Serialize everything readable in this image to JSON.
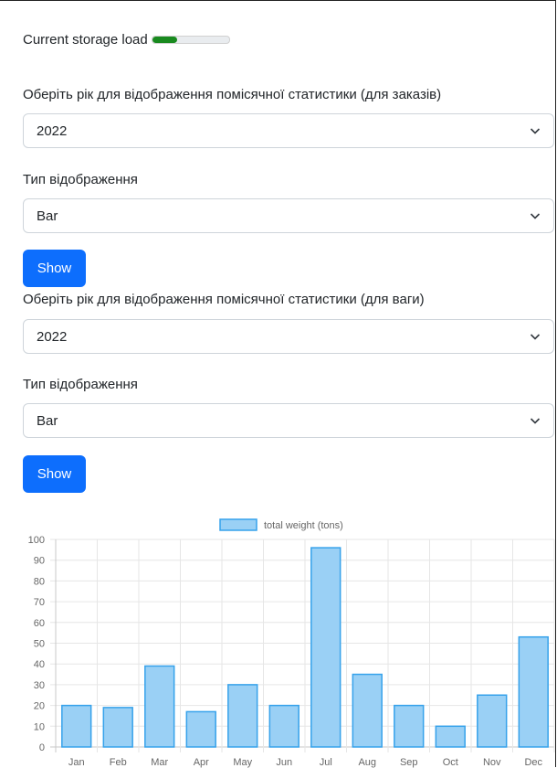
{
  "storage": {
    "label": "Current storage load",
    "fill_fraction": 0.32,
    "fill_color": "#198a1f"
  },
  "orders": {
    "year_label": "Оберіть рік для відображення помісячної статистики (для заказів)",
    "year_value": "2022",
    "type_label": "Тип відображення",
    "type_value": "Bar",
    "show_label": "Show"
  },
  "weight": {
    "year_label": "Оберіть рік для відображення помісячної статистики (для ваги)",
    "year_value": "2022",
    "type_label": "Тип відображення",
    "type_value": "Bar",
    "show_label": "Show"
  },
  "colors": {
    "primary": "#0d6efd",
    "bar_fill": "#9ad0f5",
    "bar_border": "#36a2eb"
  },
  "chart_data": {
    "type": "bar",
    "categories": [
      "Jan",
      "Feb",
      "Mar",
      "Apr",
      "May",
      "Jun",
      "Jul",
      "Aug",
      "Sep",
      "Oct",
      "Nov",
      "Dec"
    ],
    "series": [
      {
        "name": "total weight (tons)",
        "values": [
          20,
          19,
          39,
          17,
          30,
          20,
          96,
          35,
          20,
          10,
          25,
          53
        ]
      }
    ],
    "ylim": [
      0,
      100
    ],
    "yticks": [
      "0",
      "10",
      "20",
      "30",
      "40",
      "50",
      "60",
      "70",
      "80",
      "90",
      "100"
    ],
    "grid": true,
    "legend": "top-center"
  }
}
